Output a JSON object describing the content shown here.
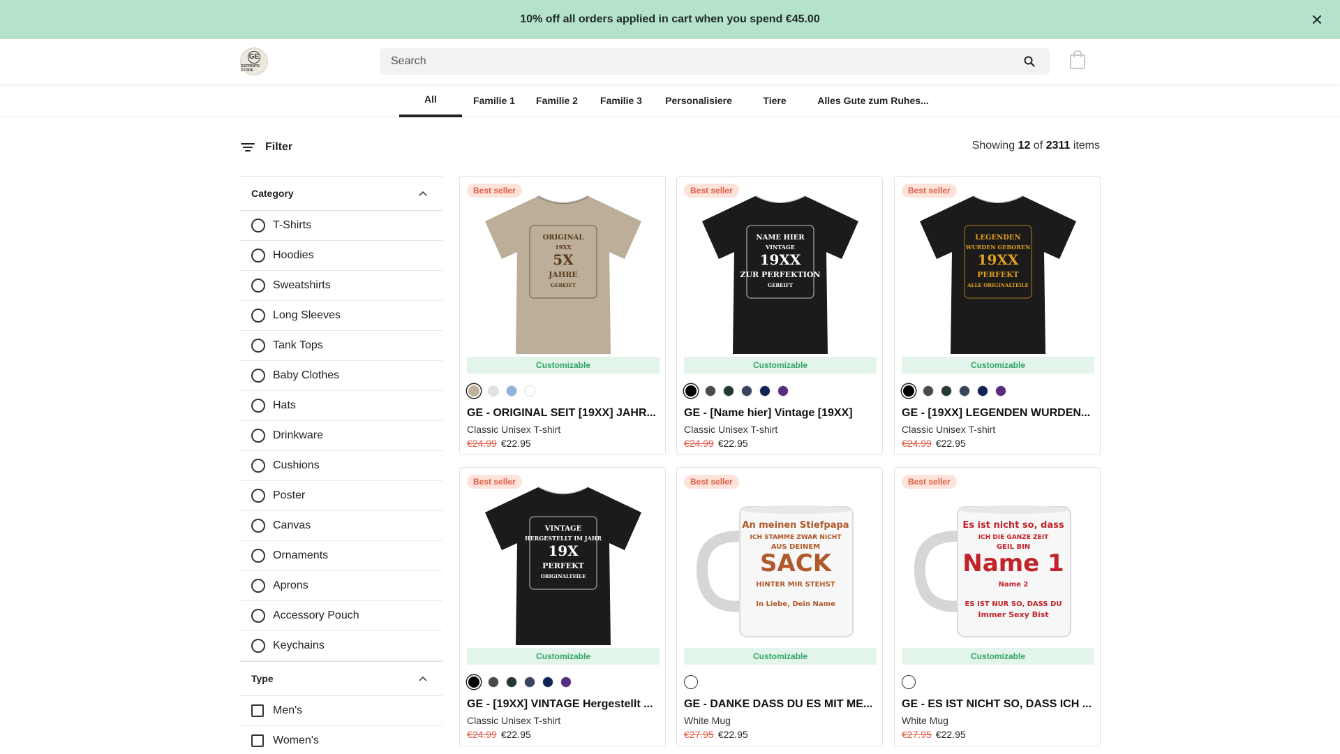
{
  "promo": {
    "text": "10% off all orders applied in cart when you spend €45.00"
  },
  "header": {
    "logo": {
      "mark": "GE",
      "text": "GEPRINTS STORE"
    },
    "search": {
      "placeholder": "Search",
      "value": ""
    }
  },
  "tabs": [
    {
      "label": "All",
      "active": true
    },
    {
      "label": "Familie 1"
    },
    {
      "label": "Familie 2"
    },
    {
      "label": "Familie 3"
    },
    {
      "label": "Personalisiere"
    },
    {
      "label": "Tiere"
    },
    {
      "label": "Alles Gute zum Ruhes..."
    }
  ],
  "filter": {
    "label": "Filter"
  },
  "showing": {
    "prefix": "Showing",
    "count": "12",
    "of": "of",
    "total": "2311",
    "suffix": "items"
  },
  "sidebar": {
    "category": {
      "title": "Category",
      "options": [
        "T-Shirts",
        "Hoodies",
        "Sweatshirts",
        "Long Sleeves",
        "Tank Tops",
        "Baby Clothes",
        "Hats",
        "Drinkware",
        "Cushions",
        "Poster",
        "Canvas",
        "Ornaments",
        "Aprons",
        "Accessory Pouch",
        "Keychains"
      ]
    },
    "type": {
      "title": "Type",
      "options": [
        "Men's",
        "Women's"
      ]
    }
  },
  "products": [
    {
      "badge": "Best seller",
      "custom": "Customizable",
      "title": "GE - ORIGINAL SEIT [19XX] JAHR...",
      "type": "Classic Unisex T-shirt",
      "old_price": "€24.99",
      "price": "€22.95",
      "art": {
        "kind": "shirt",
        "shirt_color": "#bcae98",
        "lines": [
          "ORIGINAL",
          "19XX",
          "5X",
          "JAHRE",
          "GEREIFT"
        ],
        "ink": "#5a3a1c"
      },
      "swatches": [
        "#bfb29c",
        "#e2e2e2",
        "#8db3de",
        "#ffffff"
      ]
    },
    {
      "badge": "Best seller",
      "custom": "Customizable",
      "title": "GE - [Name hier] Vintage [19XX]",
      "type": "Classic Unisex T-shirt",
      "old_price": "€24.99",
      "price": "€22.95",
      "art": {
        "kind": "shirt",
        "shirt_color": "#1b1b1b",
        "lines": [
          "NAME HIER",
          "VINTAGE",
          "19XX",
          "ZUR PERFEKTION",
          "GEREIFT"
        ],
        "ink": "#ffffff"
      },
      "swatches": [
        "#000000",
        "#4a4a4a",
        "#233a2f",
        "#39445f",
        "#0f2356",
        "#5a2d82"
      ]
    },
    {
      "badge": "Best seller",
      "custom": "Customizable",
      "title": "GE - [19XX] LEGENDEN WURDEN...",
      "type": "Classic Unisex T-shirt",
      "old_price": "€24.99",
      "price": "€22.95",
      "art": {
        "kind": "shirt",
        "shirt_color": "#1b1b1b",
        "lines": [
          "LEGENDEN",
          "WURDEN GEBOREN",
          "19XX",
          "PERFEKT",
          "ALLE ORIGINALTEILE"
        ],
        "ink": "#e0a020"
      },
      "swatches": [
        "#000000",
        "#4a4a4a",
        "#233a2f",
        "#39445f",
        "#0f2356",
        "#5a2d82"
      ]
    },
    {
      "badge": "Best seller",
      "custom": "Customizable",
      "title": "GE - [19XX] VINTAGE Hergestellt ...",
      "type": "Classic Unisex T-shirt",
      "old_price": "€24.99",
      "price": "€22.95",
      "art": {
        "kind": "shirt",
        "shirt_color": "#1b1b1b",
        "lines": [
          "VINTAGE",
          "HERGESTELLT IM JAHR",
          "19X",
          "PERFEKT",
          "ORIGINALTEILE"
        ],
        "ink": "#ffffff"
      },
      "swatches": [
        "#000000",
        "#4a4a4a",
        "#233a2f",
        "#39445f",
        "#0f2356",
        "#5a2d82"
      ]
    },
    {
      "badge": "Best seller",
      "custom": "Customizable",
      "title": "GE - DANKE DASS DU ES MIT ME...",
      "type": "White Mug",
      "old_price": "€27.95",
      "price": "€22.95",
      "art": {
        "kind": "mug",
        "lines": [
          "An meinen Stiefpapa",
          "ICH STAMME ZWAR NICHT",
          "AUS DEINEM",
          "SACK",
          "HINTER MIR STEHST",
          "In Liebe, Dein Name"
        ],
        "ink": "#b0582a"
      },
      "swatches": [
        "#ffffff"
      ]
    },
    {
      "badge": "Best seller",
      "custom": "Customizable",
      "title": "GE - ES IST NICHT SO, DASS ICH ...",
      "type": "White Mug",
      "old_price": "€27.95",
      "price": "€22.95",
      "art": {
        "kind": "mug",
        "lines": [
          "Es ist nicht so, dass",
          "ICH DIE GANZE ZEIT",
          "GEIL BIN",
          "Name 1",
          "Name 2",
          "ES IST NUR SO, DASS DU",
          "Immer Sexy Bist"
        ],
        "ink": "#c0232a"
      },
      "swatches": [
        "#ffffff"
      ]
    }
  ]
}
